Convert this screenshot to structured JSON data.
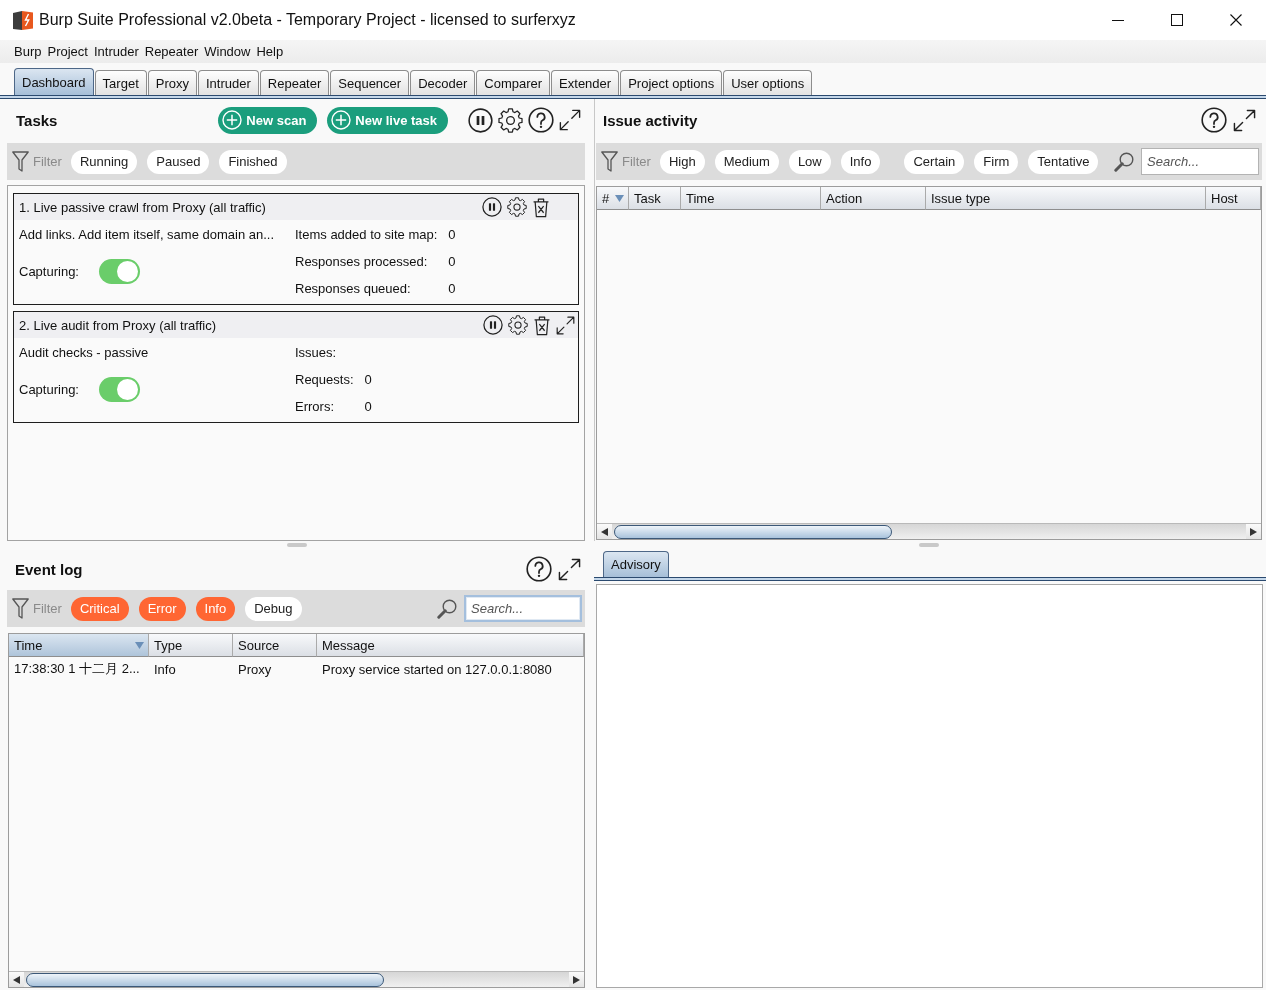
{
  "window": {
    "title": "Burp Suite Professional v2.0beta - Temporary Project - licensed to surferxyz"
  },
  "menu": [
    "Burp",
    "Project",
    "Intruder",
    "Repeater",
    "Window",
    "Help"
  ],
  "tabs": [
    {
      "label": "Dashboard",
      "selected": true
    },
    {
      "label": "Target",
      "selected": false
    },
    {
      "label": "Proxy",
      "selected": false
    },
    {
      "label": "Intruder",
      "selected": false
    },
    {
      "label": "Repeater",
      "selected": false
    },
    {
      "label": "Sequencer",
      "selected": false
    },
    {
      "label": "Decoder",
      "selected": false
    },
    {
      "label": "Comparer",
      "selected": false
    },
    {
      "label": "Extender",
      "selected": false
    },
    {
      "label": "Project options",
      "selected": false
    },
    {
      "label": "User options",
      "selected": false
    }
  ],
  "tasks": {
    "title": "Tasks",
    "buttons": [
      "New scan",
      "New live task"
    ],
    "filter": {
      "label": "Filter",
      "groups": [
        {
          "filters": [
            {
              "label": "Running",
              "selected": false
            },
            {
              "label": "Paused",
              "selected": false
            },
            {
              "label": "Finished",
              "selected": false
            }
          ]
        }
      ]
    },
    "items": [
      {
        "title": "1. Live passive crawl from Proxy (all traffic)",
        "description": "Add links. Add item itself, same domain an...",
        "capturing_label": "Capturing:",
        "capturing": true,
        "expand_button": false,
        "stats": [
          {
            "label": "Items added to site map:",
            "value": "0"
          },
          {
            "label": "Responses processed:",
            "value": "0"
          },
          {
            "label": "Responses queued:",
            "value": "0"
          }
        ]
      },
      {
        "title": "2. Live audit from Proxy (all traffic)",
        "description": "Audit checks - passive",
        "capturing_label": "Capturing:",
        "capturing": true,
        "expand_button": true,
        "stats": [
          {
            "label": "Issues:"
          },
          {
            "label": "Requests:",
            "value": "0"
          },
          {
            "label": "Errors:",
            "value": "0"
          }
        ]
      }
    ]
  },
  "issue_activity": {
    "title": "Issue activity",
    "filter": {
      "label": "Filter",
      "groups": [
        {
          "filters": [
            {
              "label": "High",
              "selected": false
            },
            {
              "label": "Medium",
              "selected": false
            },
            {
              "label": "Low",
              "selected": false
            },
            {
              "label": "Info",
              "selected": false
            }
          ]
        },
        {
          "filters": [
            {
              "label": "Certain",
              "selected": false
            },
            {
              "label": "Firm",
              "selected": false
            },
            {
              "label": "Tentative",
              "selected": false
            }
          ]
        }
      ],
      "search": {
        "placeholder": "Search...",
        "focused": false
      }
    },
    "table": {
      "columns": [
        {
          "label": "#",
          "sorted": true,
          "selected": false
        },
        {
          "label": "Task",
          "sorted": false,
          "selected": false
        },
        {
          "label": "Time",
          "sorted": false,
          "selected": false
        },
        {
          "label": "Action",
          "sorted": false,
          "selected": false
        },
        {
          "label": "Issue type",
          "sorted": false,
          "selected": false
        },
        {
          "label": "Host",
          "sorted": false,
          "selected": false
        }
      ]
    }
  },
  "event_log": {
    "title": "Event log",
    "filter": {
      "label": "Filter",
      "groups": [
        {
          "filters": [
            {
              "label": "Critical",
              "selected": true
            },
            {
              "label": "Error",
              "selected": true
            },
            {
              "label": "Info",
              "selected": true
            },
            {
              "label": "Debug",
              "selected": false
            }
          ]
        }
      ],
      "search": {
        "placeholder": "Search...",
        "focused": true
      }
    },
    "table": {
      "columns": [
        {
          "label": "Time",
          "sorted": true,
          "selected": true
        },
        {
          "label": "Type",
          "sorted": false,
          "selected": false
        },
        {
          "label": "Source",
          "sorted": false,
          "selected": false
        },
        {
          "label": "Message",
          "sorted": false,
          "selected": false
        }
      ],
      "rows": [
        [
          "17:38:30 1 十二月 2...",
          "Info",
          "Proxy",
          "Proxy service started on 127.0.0.1:8080"
        ]
      ]
    }
  },
  "advisory": {
    "tabs": [
      {
        "label": "Advisory",
        "selected": true
      }
    ]
  }
}
